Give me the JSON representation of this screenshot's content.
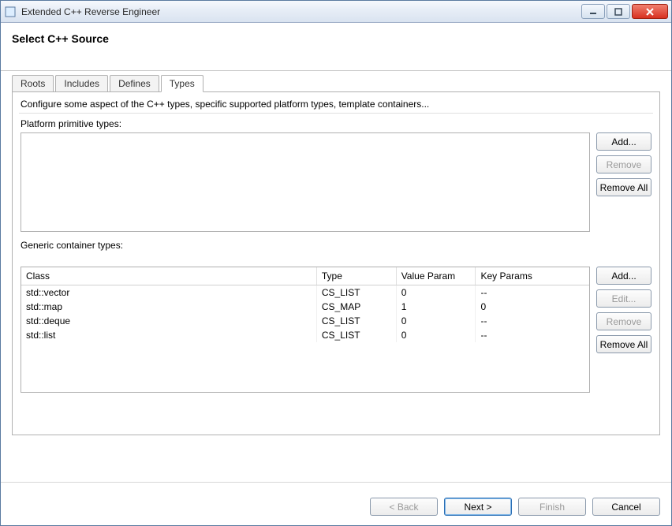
{
  "window": {
    "title": "Extended C++ Reverse Engineer"
  },
  "header": {
    "title": "Select C++ Source"
  },
  "tabs": [
    {
      "label": "Roots",
      "active": false
    },
    {
      "label": "Includes",
      "active": false
    },
    {
      "label": "Defines",
      "active": false
    },
    {
      "label": "Types",
      "active": true
    }
  ],
  "panel": {
    "desc": "Configure some aspect of the C++ types, specific supported platform types, template containers...",
    "primitive_label": "Platform primitive types:",
    "primitive_buttons": {
      "add": "Add...",
      "remove": "Remove",
      "remove_all": "Remove All"
    },
    "generic_label": "Generic container types:",
    "table": {
      "headers": {
        "class": "Class",
        "type": "Type",
        "value_param": "Value Param",
        "key_params": "Key Params"
      },
      "rows": [
        {
          "class": "std::vector",
          "type": "CS_LIST",
          "value_param": "0",
          "key_params": "--"
        },
        {
          "class": "std::map",
          "type": "CS_MAP",
          "value_param": "1",
          "key_params": "0"
        },
        {
          "class": "std::deque",
          "type": "CS_LIST",
          "value_param": "0",
          "key_params": "--"
        },
        {
          "class": "std::list",
          "type": "CS_LIST",
          "value_param": "0",
          "key_params": "--"
        }
      ]
    },
    "generic_buttons": {
      "add": "Add...",
      "edit": "Edit...",
      "remove": "Remove",
      "remove_all": "Remove All"
    }
  },
  "footer": {
    "back": "< Back",
    "next": "Next >",
    "finish": "Finish",
    "cancel": "Cancel"
  }
}
